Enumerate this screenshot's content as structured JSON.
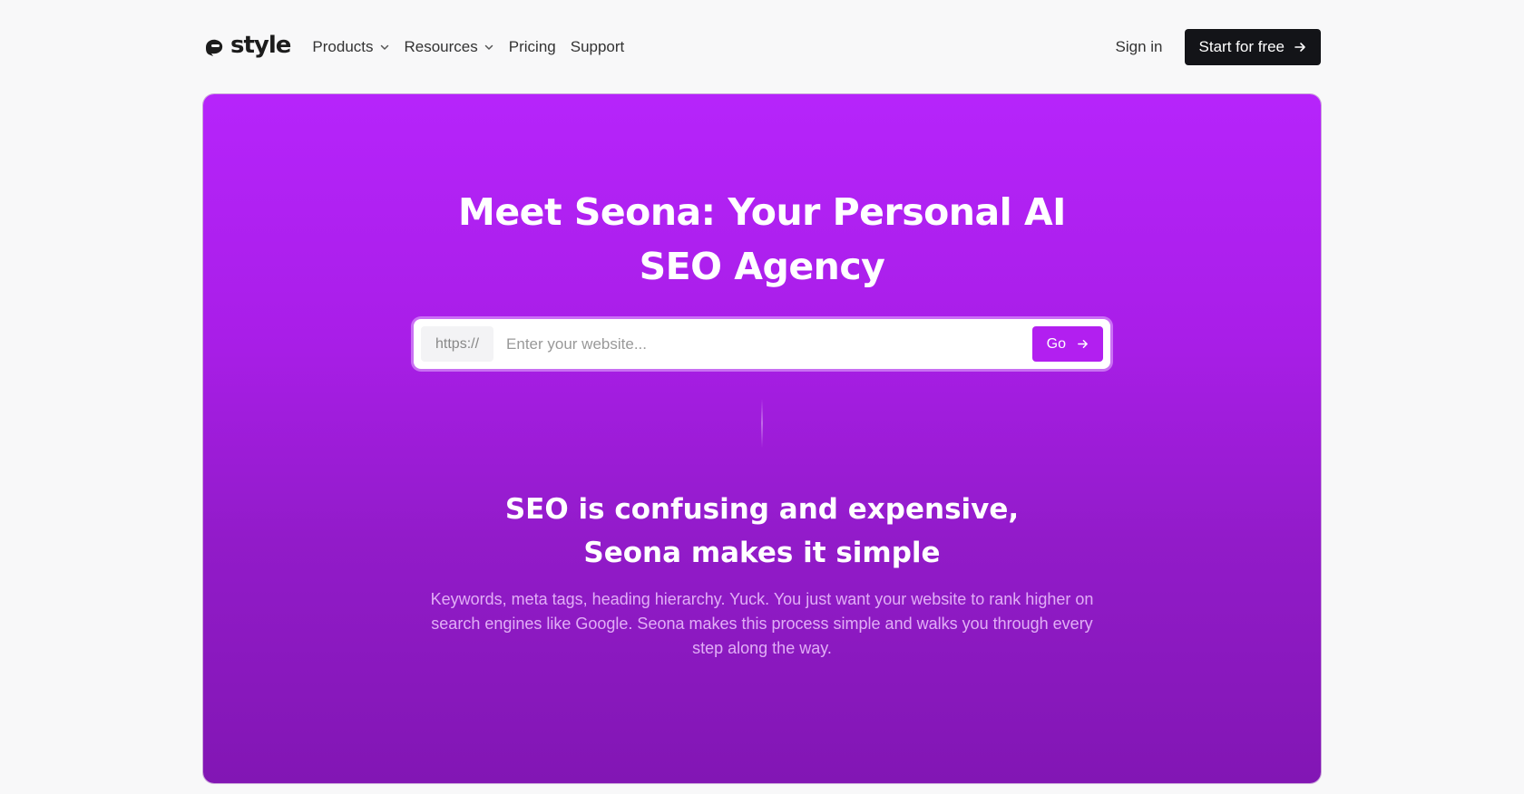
{
  "nav": {
    "logo": "style",
    "items": [
      {
        "label": "Products",
        "dropdown": true
      },
      {
        "label": "Resources",
        "dropdown": true
      },
      {
        "label": "Pricing",
        "dropdown": false
      },
      {
        "label": "Support",
        "dropdown": false
      }
    ],
    "sign_in": "Sign in",
    "cta": "Start for free"
  },
  "hero": {
    "title": "Meet Seona: Your Personal AI SEO Agency",
    "url_prefix": "https://",
    "url_placeholder": "Enter your website...",
    "go_label": "Go",
    "subtitle_line1": "SEO is confusing and expensive,",
    "subtitle_line2": "Seona makes it simple",
    "description": "Keywords, meta tags, heading hierarchy. Yuck. You just want your website to rank higher on search engines like Google. Seona makes this process simple and walks you through every step along the way."
  },
  "colors": {
    "hero_top": "#b624fb",
    "hero_bottom": "#8216b4",
    "go_button": "#b21ff0",
    "cta_button": "#131418"
  },
  "icons": {
    "logo": "style-logo-icon",
    "dropdown": "chevron-down-icon",
    "arrow": "arrow-right-icon"
  }
}
